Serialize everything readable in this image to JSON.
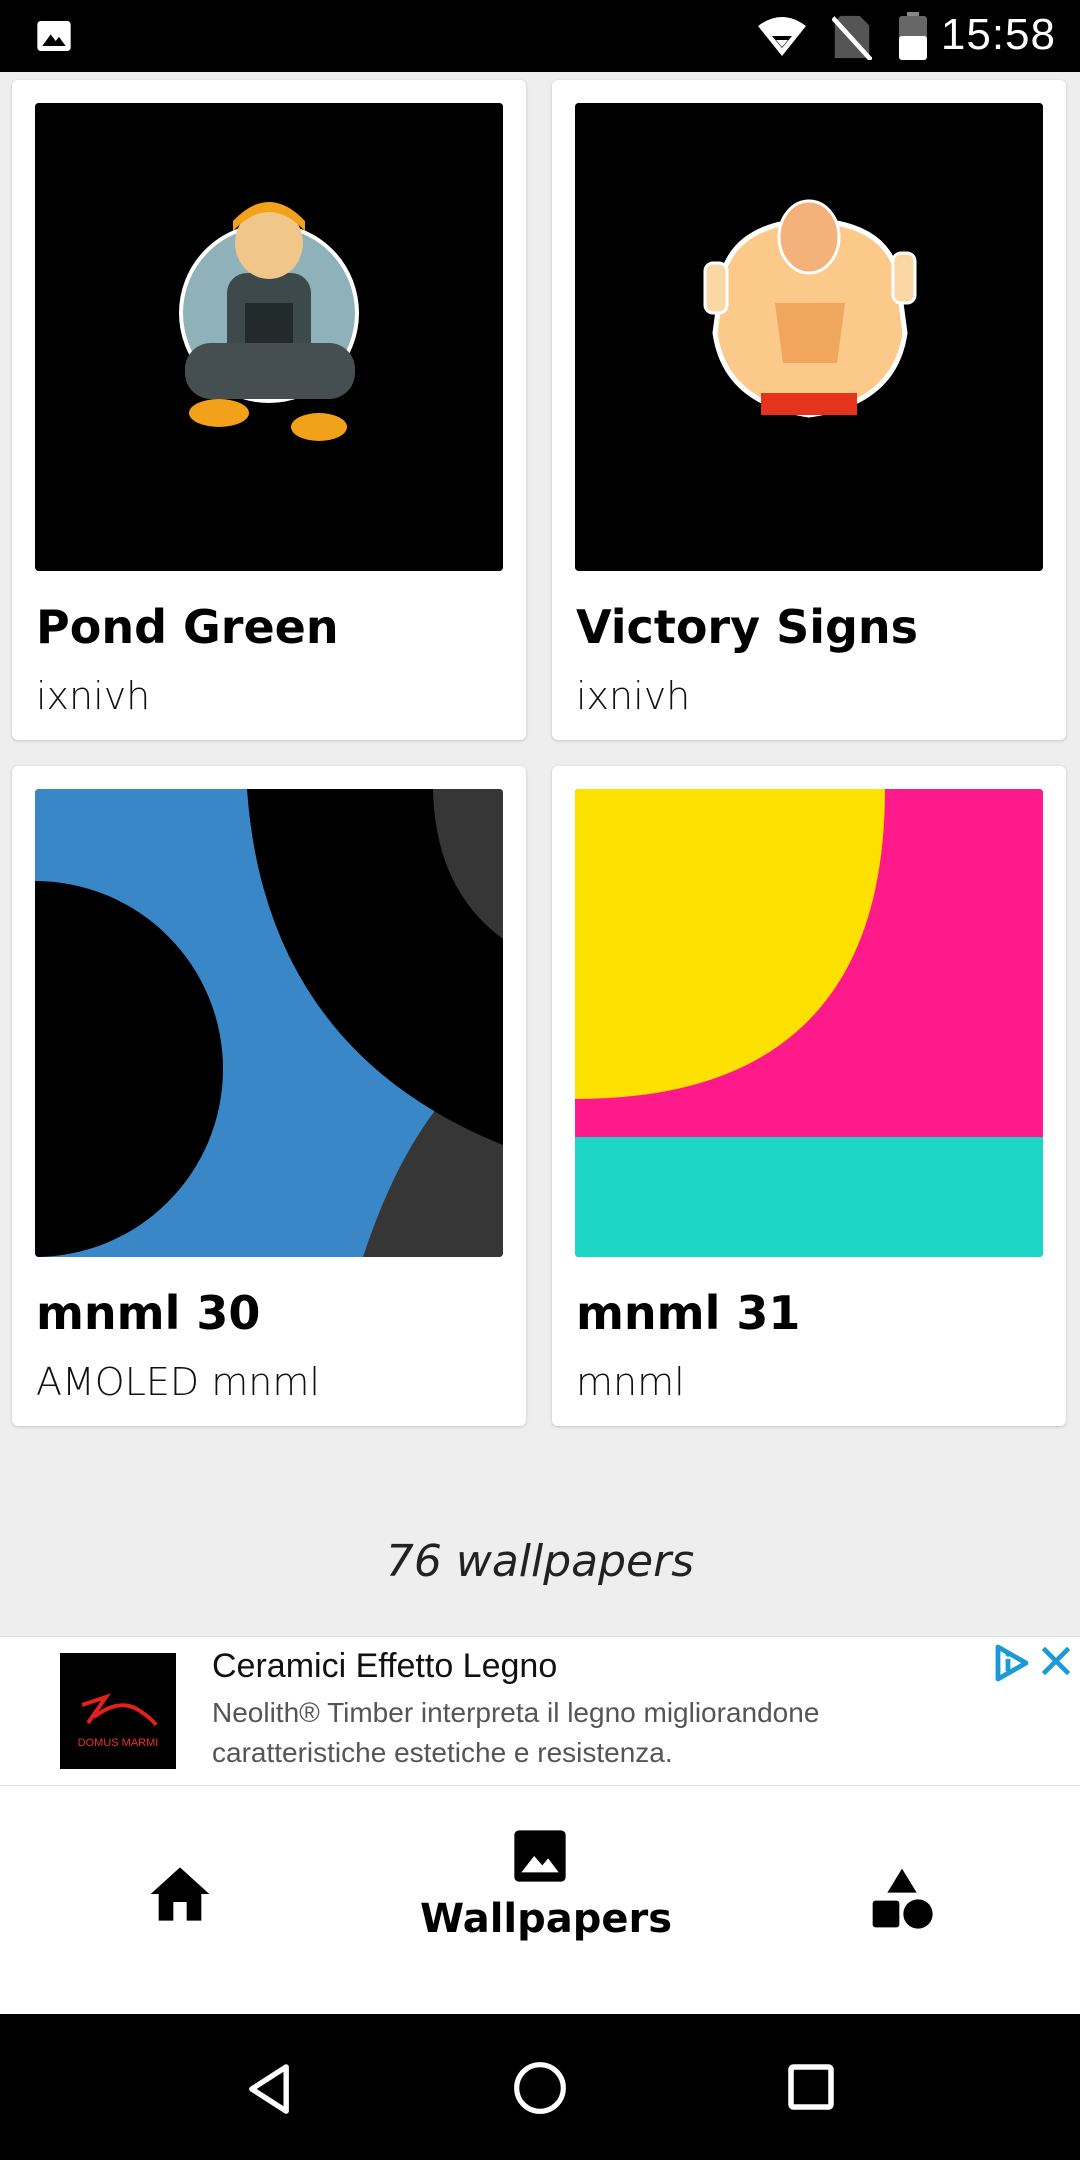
{
  "status_bar": {
    "time": "15:58",
    "icons": [
      "image-icon",
      "wifi-icon",
      "no-sim-icon",
      "battery-icon"
    ]
  },
  "wallpapers": [
    {
      "title": "Pond Green",
      "author": "ixnivh",
      "thumb": "illustration-sitting-person"
    },
    {
      "title": "Victory Signs",
      "author": "ixnivh",
      "thumb": "illustration-victory-signs"
    },
    {
      "title": "mnml 30",
      "author": "AMOLED mnml",
      "thumb": "abstract-blue-black"
    },
    {
      "title": "mnml 31",
      "author": "mnml",
      "thumb": "abstract-yellow-pink-teal"
    }
  ],
  "count_label": "76 wallpapers",
  "ad": {
    "logo_text": "DOMUS MARMI",
    "title": "Ceramici Effetto Legno",
    "description": "Neolith® Timber interpreta il legno migliorandone caratteristiche estetiche e resistenza."
  },
  "bottom_nav": {
    "items": [
      {
        "icon": "home-icon"
      },
      {
        "icon": "image-icon",
        "label": "Wallpapers",
        "active": true
      },
      {
        "icon": "shapes-icon"
      }
    ]
  },
  "colors": {
    "accent_blue": "#3a87c8",
    "yellow": "#fce100",
    "pink": "#ff1a8c",
    "teal": "#1dd6c6",
    "ad_blue": "#1a9bd7"
  }
}
